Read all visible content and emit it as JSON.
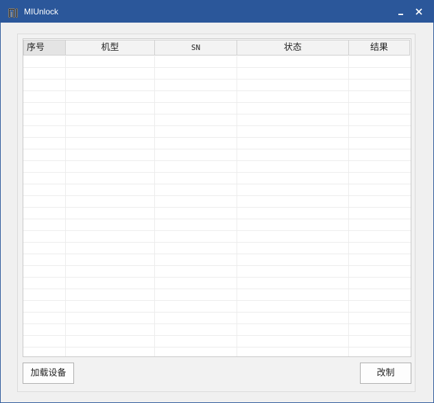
{
  "window": {
    "title": "MIUnlock",
    "logo_icon": "mi-logo-icon",
    "titlebar_color": "#2b579a",
    "minimize_icon": "minimize-icon",
    "close_icon": "close-icon"
  },
  "table": {
    "columns": [
      "序号",
      "机型",
      "SN",
      "状态",
      "结果"
    ],
    "rows": []
  },
  "buttons": {
    "load_devices": "加载设备",
    "make": "改制"
  }
}
